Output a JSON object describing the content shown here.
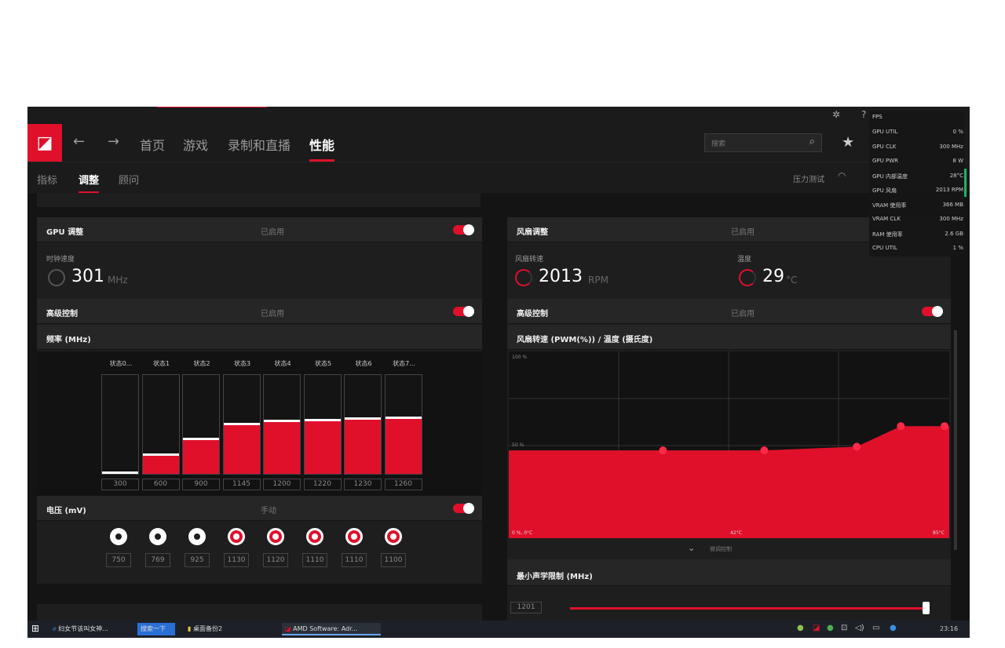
{
  "nav": {
    "items": [
      "首页",
      "游戏",
      "录制和直播",
      "性能"
    ],
    "active": "性能",
    "search_placeholder": "搜索"
  },
  "subnav": {
    "items": [
      "指标",
      "调整",
      "顾问"
    ],
    "active": "调整",
    "stress_test": "压力测试"
  },
  "gpu_tuning": {
    "title": "GPU 调整",
    "status": "已启用",
    "clock_label": "时钟速度",
    "clock_value": "301",
    "clock_unit": "MHz",
    "advanced_label": "高级控制",
    "advanced_status": "已启用",
    "freq_label": "频率 (MHz)",
    "states": [
      "状态0...",
      "状态1",
      "状态2",
      "状态3",
      "状态4",
      "状态5",
      "状态6",
      "状态7..."
    ],
    "freq_values": [
      "300",
      "600",
      "900",
      "1145",
      "1200",
      "1220",
      "1230",
      "1260"
    ],
    "freq_fill": [
      0.02,
      0.2,
      0.36,
      0.51,
      0.54,
      0.55,
      0.56,
      0.57
    ],
    "voltage_label": "电压 (mV)",
    "voltage_mode": "手动",
    "voltage_values": [
      "750",
      "769",
      "925",
      "1130",
      "1120",
      "1110",
      "1110",
      "1100"
    ]
  },
  "fan_tuning": {
    "title": "风扇调整",
    "status": "已启用",
    "speed_label": "风扇转速",
    "speed_value": "2013",
    "speed_unit": "RPM",
    "temp_label": "温度",
    "temp_value": "29",
    "temp_unit": "°C",
    "advanced_label": "高级控制",
    "advanced_status": "已启用",
    "curve_label": "风扇转速 (PWM(%)) / 温度 (摄氏度)",
    "y_top": "100 %",
    "y_mid": "50 %",
    "x_origin": "0 %, 0°C",
    "x_mid": "42°C",
    "x_end": "85°C",
    "fine_tune": "微调控制",
    "acoustic_label": "最小声学限制 (MHz)",
    "acoustic_value": "1201"
  },
  "chart_data": {
    "type": "area",
    "title": "风扇转速 (PWM(%)) / 温度 (摄氏度)",
    "points_pct_of_plot": [
      [
        0.35,
        0.47
      ],
      [
        0.58,
        0.47
      ],
      [
        0.79,
        0.49
      ],
      [
        0.89,
        0.6
      ],
      [
        1.0,
        0.6
      ]
    ]
  },
  "overlay": {
    "fps_label": "FPS",
    "rows": [
      {
        "k": "GPU UTIL",
        "v": "0 %"
      },
      {
        "k": "GPU CLK",
        "v": "300 MHz"
      },
      {
        "k": "GPU PWR",
        "v": "8 W"
      },
      {
        "k": "GPU 内部温度",
        "v": "28°C"
      },
      {
        "k": "GPU 风扇",
        "v": "2013 RPM"
      },
      {
        "k": "VRAM 使用率",
        "v": "366 MB"
      },
      {
        "k": "VRAM CLK",
        "v": "300 MHz"
      },
      {
        "k": "RAM 使用率",
        "v": "2.6 GB"
      },
      {
        "k": "CPU UTIL",
        "v": "1 %"
      }
    ]
  },
  "taskbar": {
    "items": [
      "妇女节该叫女神...",
      "搜索一下",
      "桌面备份2",
      "AMD Software: Adr..."
    ],
    "clock": "23:16"
  }
}
